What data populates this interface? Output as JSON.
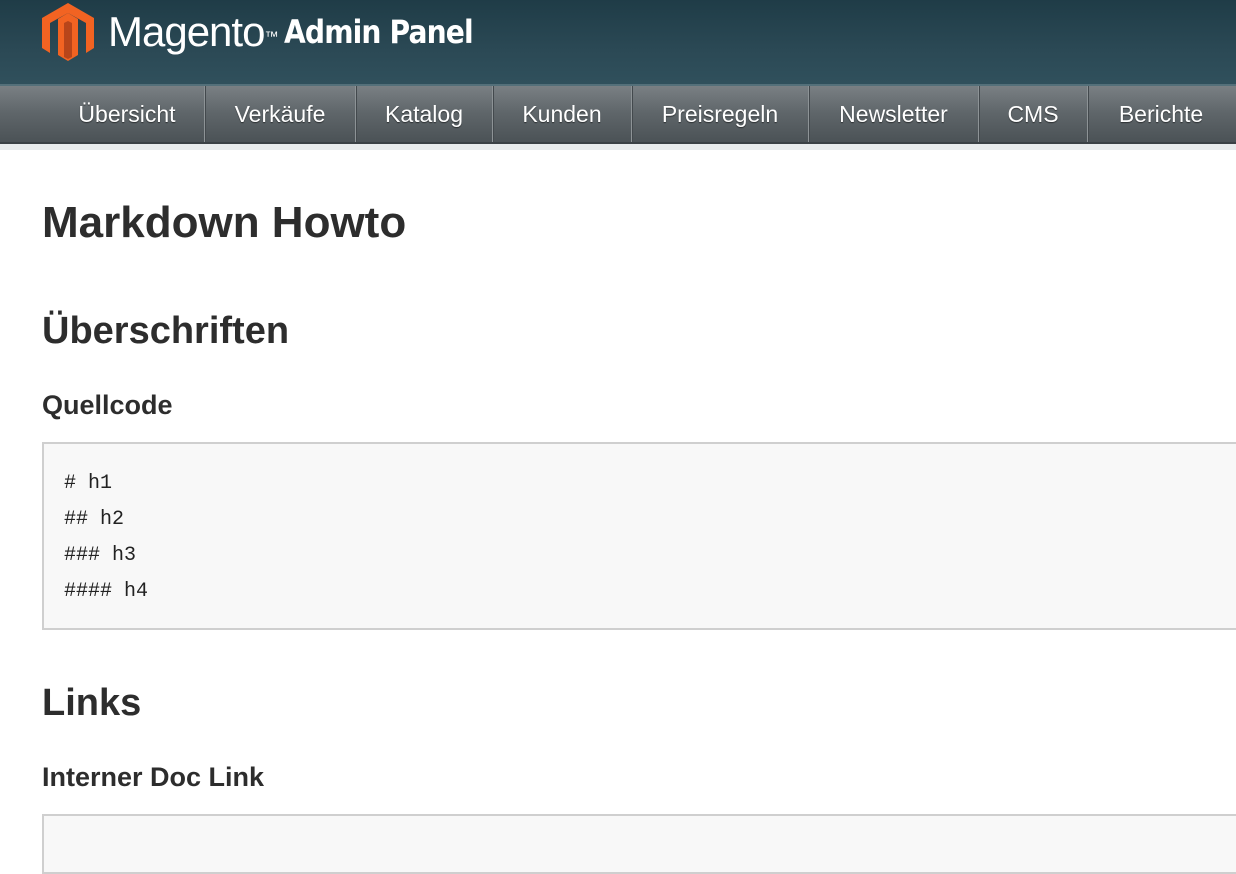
{
  "header": {
    "brand": "Magento",
    "tm": "™",
    "subtitle": "Admin Panel",
    "logo_colors": {
      "primary": "#f26322",
      "dark": "#b8451a"
    }
  },
  "nav": {
    "items": [
      {
        "label": "Übersicht"
      },
      {
        "label": "Verkäufe"
      },
      {
        "label": "Katalog"
      },
      {
        "label": "Kunden"
      },
      {
        "label": "Preisregeln"
      },
      {
        "label": "Newsletter"
      },
      {
        "label": "CMS"
      },
      {
        "label": "Berichte"
      }
    ]
  },
  "content": {
    "title": "Markdown Howto",
    "sections": [
      {
        "heading": "Überschriften",
        "subheading": "Quellcode",
        "code": [
          "# h1",
          "## h2",
          "### h3",
          "#### h4"
        ]
      },
      {
        "heading": "Links",
        "subheading": "Interner Doc Link"
      }
    ]
  }
}
